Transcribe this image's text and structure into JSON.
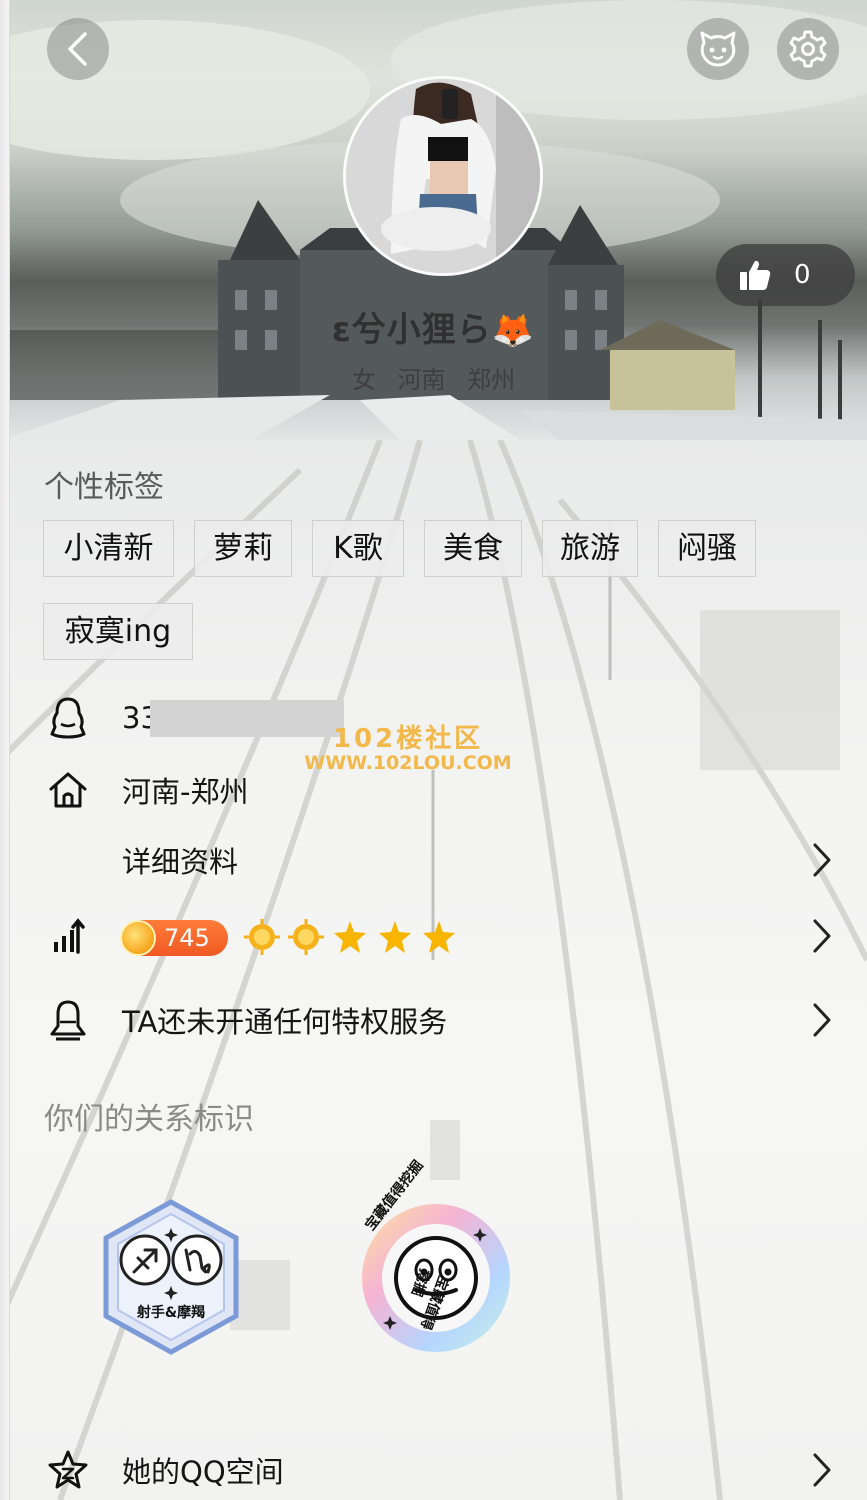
{
  "header": {
    "back_icon": "chevron-left-icon",
    "pet_icon": "pet-face-icon",
    "settings_icon": "gear-icon"
  },
  "profile": {
    "nickname": "ε兮小狸ら",
    "nickname_emoji": "🦊",
    "subinfo": "女  河南 郑州",
    "likes": "0"
  },
  "tags_section": {
    "title": "个性标签",
    "tags": [
      "小清新",
      "萝莉",
      "K歌",
      "美食",
      "旅游",
      "闷骚",
      "寂寞ing"
    ]
  },
  "info": {
    "qq_number_visible": "33",
    "location": "河南-郑州",
    "details_label": "详细资料",
    "level": "745",
    "privilege_text": "TA还未开通任何特权服务"
  },
  "watermark": {
    "line1": "102楼社区",
    "line2": "WWW.102LOU.COM"
  },
  "relation": {
    "title": "你们的关系标识",
    "badge1_label": "射手&摩羯",
    "badge2_label": "宝藏值得挖掘"
  },
  "qzone": {
    "label": "她的QQ空间"
  },
  "colors": {
    "accent_orange": "#f05a22",
    "star_gold": "#f7b500",
    "badge_blue": "#3b5bb5"
  }
}
